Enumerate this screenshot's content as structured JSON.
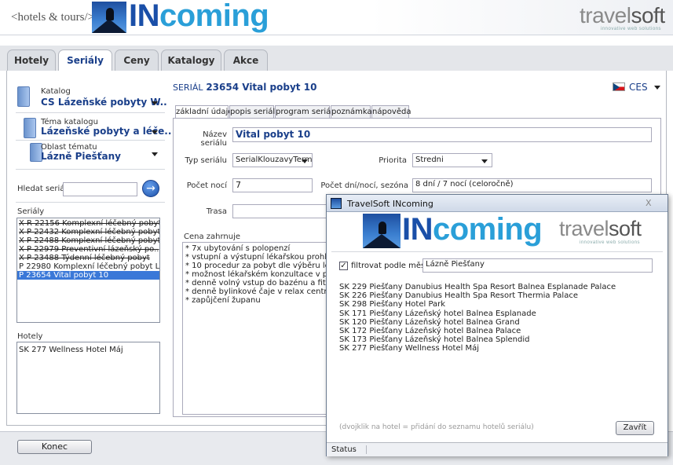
{
  "header": {
    "tagline": "<hotels & tours/>",
    "logo_in": "IN",
    "logo_rest": "coming",
    "brand_travel": "travel",
    "brand_soft": "soft",
    "brand_sub": "innovative web solutions"
  },
  "tabs": [
    {
      "label": "Hotely",
      "active": false
    },
    {
      "label": "Seriály",
      "active": true
    },
    {
      "label": "Ceny",
      "active": false
    },
    {
      "label": "Katalogy",
      "active": false
    },
    {
      "label": "Akce",
      "active": false
    }
  ],
  "sidebar": {
    "katalog_label": "Katalog",
    "katalog_value": "CS Lázeňské pobyty  W..",
    "tema_label": "Téma katalogu",
    "tema_value": "Lázeňské pobyty a léče..",
    "oblast_label": "Oblast tématu",
    "oblast_value": "Lázně Piešťany",
    "search_label": "Hledat seriál",
    "search_value": "",
    "serialy_label": "Seriály",
    "serialy": [
      {
        "text": "X R 22156 Komplexní léčebný pobyt..",
        "strike": true,
        "selected": false
      },
      {
        "text": "X P 22432 Komplexní léčebný pobyt",
        "strike": true,
        "selected": false
      },
      {
        "text": "X P 22488 Komplexní léčebný pobyt",
        "strike": true,
        "selected": false
      },
      {
        "text": "X P 22979 Preventivní lázeňský po..",
        "strike": true,
        "selected": false
      },
      {
        "text": "X P 23488 Týdenní léčebný pobyt",
        "strike": true,
        "selected": false
      },
      {
        "text": "P 22980 Komplexní léčebný pobyt L..",
        "strike": false,
        "selected": false
      },
      {
        "text": "P 23654 Vital pobyt 10",
        "strike": false,
        "selected": true
      }
    ],
    "hotely_label": "Hotely",
    "hotely": [
      "SK 277 Wellness Hotel Máj"
    ]
  },
  "content": {
    "serial_prefix": "SERIÁL",
    "serial_title": "23654 Vital pobyt 10",
    "lang": "CES",
    "subtabs": [
      {
        "label": "základní údaje",
        "active": true
      },
      {
        "label": "popis seriálu",
        "active": false
      },
      {
        "label": "program seriálu",
        "active": false
      },
      {
        "label": "poznámka",
        "active": false
      },
      {
        "label": "nápověda",
        "active": false
      }
    ],
    "form": {
      "nazev_label": "Název seriálu",
      "nazev_value": "Vital pobyt 10",
      "typ_label": "Typ seriálu",
      "typ_value": "SerialKlouzavyTermir",
      "priorita_label": "Priorita",
      "priorita_value": "Stredni",
      "noci_label": "Počet nocí",
      "noci_value": "7",
      "sezona_label": "Počet dní/nocí, sezóna",
      "sezona_value": "8 dní / 7 nocí (celoročně)",
      "trasa_label": "Trasa",
      "trasa_value": "",
      "cena_label": "Cena zahrnuje",
      "cena_lines": [
        "* 7x ubytování s polopenzí",
        "* vstupní a výstupní lékařskou prohlídku vč",
        "* 10 procedur za pobyt dle výběru lékaře",
        "* možnost lékařském konzultace v průběhu",
        "* denně volný vstup do bazénu a fitness",
        "* denně bylinkové čaje v relax centru",
        "* zapůjčení županu"
      ]
    }
  },
  "footer": {
    "konec_label": "Konec"
  },
  "dialog": {
    "title": "TravelSoft INcoming",
    "close_label": "X",
    "filter_checked": true,
    "filter_mark": "✓",
    "filter_label": "filtrovat podle města",
    "filter_value": "Lázně Piešťany",
    "hotels": [
      "SK 229 Piešťany Danubius Health Spa Resort  Balnea Esplanade Palace",
      "SK 226 Piešťany Danubius Health Spa Resort Thermia  Palace",
      "SK 298 Piešťany Hotel Park",
      "SK 171 Piešťany Lázeňský hotel Balnea Esplanade",
      "SK 120 Piešťany Lázeňský hotel Balnea Grand",
      "SK 172 Piešťany Lázeňský hotel Balnea Palace",
      "SK 173 Piešťany Lázeňský hotel Balnea Splendid",
      "SK 277 Piešťany Wellness Hotel Máj"
    ],
    "hint": "(dvojklik na hotel = přidání do seznamu hotelů seriálu)",
    "close_button": "Zavřít",
    "status": "Status"
  }
}
